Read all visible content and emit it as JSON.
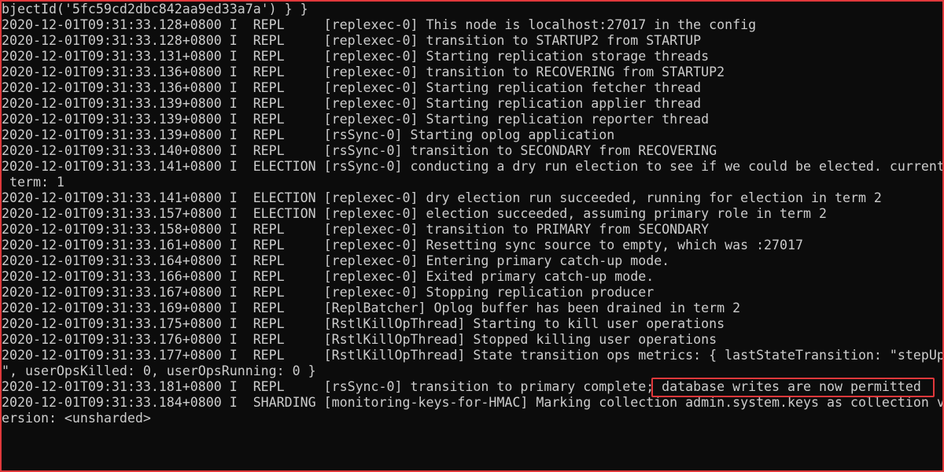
{
  "console": {
    "lines": [
      "bjectId('5fc59cd2dbc842aa9ed33a7a') } }",
      "2020-12-01T09:31:33.128+0800 I  REPL     [replexec-0] This node is localhost:27017 in the config",
      "2020-12-01T09:31:33.128+0800 I  REPL     [replexec-0] transition to STARTUP2 from STARTUP",
      "2020-12-01T09:31:33.131+0800 I  REPL     [replexec-0] Starting replication storage threads",
      "2020-12-01T09:31:33.136+0800 I  REPL     [replexec-0] transition to RECOVERING from STARTUP2",
      "2020-12-01T09:31:33.136+0800 I  REPL     [replexec-0] Starting replication fetcher thread",
      "2020-12-01T09:31:33.139+0800 I  REPL     [replexec-0] Starting replication applier thread",
      "2020-12-01T09:31:33.139+0800 I  REPL     [replexec-0] Starting replication reporter thread",
      "2020-12-01T09:31:33.139+0800 I  REPL     [rsSync-0] Starting oplog application",
      "2020-12-01T09:31:33.140+0800 I  REPL     [rsSync-0] transition to SECONDARY from RECOVERING",
      "2020-12-01T09:31:33.141+0800 I  ELECTION [rsSync-0] conducting a dry run election to see if we could be elected. current",
      " term: 1",
      "2020-12-01T09:31:33.141+0800 I  ELECTION [replexec-0] dry election run succeeded, running for election in term 2",
      "2020-12-01T09:31:33.157+0800 I  ELECTION [replexec-0] election succeeded, assuming primary role in term 2",
      "2020-12-01T09:31:33.158+0800 I  REPL     [replexec-0] transition to PRIMARY from SECONDARY",
      "2020-12-01T09:31:33.161+0800 I  REPL     [replexec-0] Resetting sync source to empty, which was :27017",
      "2020-12-01T09:31:33.164+0800 I  REPL     [replexec-0] Entering primary catch-up mode.",
      "2020-12-01T09:31:33.166+0800 I  REPL     [replexec-0] Exited primary catch-up mode.",
      "2020-12-01T09:31:33.167+0800 I  REPL     [replexec-0] Stopping replication producer",
      "2020-12-01T09:31:33.169+0800 I  REPL     [ReplBatcher] Oplog buffer has been drained in term 2",
      "2020-12-01T09:31:33.175+0800 I  REPL     [RstlKillOpThread] Starting to kill user operations",
      "2020-12-01T09:31:33.176+0800 I  REPL     [RstlKillOpThread] Stopped killing user operations",
      "2020-12-01T09:31:33.177+0800 I  REPL     [RstlKillOpThread] State transition ops metrics: { lastStateTransition: \"stepUp",
      "\", userOpsKilled: 0, userOpsRunning: 0 }",
      "2020-12-01T09:31:33.181+0800 I  REPL     [rsSync-0] transition to primary complete; database writes are now permitted",
      "2020-12-01T09:31:33.184+0800 I  SHARDING [monitoring-keys-for-HMAC] Marking collection admin.system.keys as collection v",
      "ersion: <unsharded>"
    ]
  },
  "colors": {
    "background": "#0c0c0c",
    "text": "#cccccc",
    "frame_border": "#e0383b",
    "annotation_box": "#e0383b"
  }
}
